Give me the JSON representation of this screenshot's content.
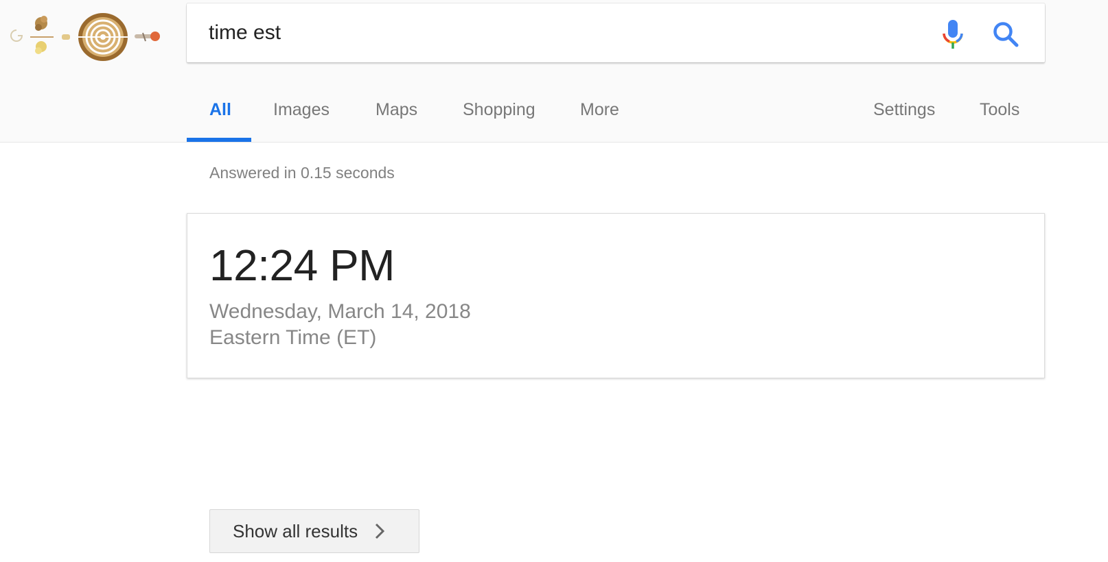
{
  "doodle": {
    "name": "google-doodle-logo"
  },
  "search": {
    "query": "time est",
    "mic_icon": "mic-icon",
    "search_icon": "search-icon"
  },
  "tabs": [
    {
      "label": "All",
      "active": true
    },
    {
      "label": "Images",
      "active": false
    },
    {
      "label": "Maps",
      "active": false
    },
    {
      "label": "Shopping",
      "active": false
    },
    {
      "label": "More",
      "active": false
    }
  ],
  "right_tabs": [
    {
      "label": "Settings"
    },
    {
      "label": "Tools"
    }
  ],
  "stats": "Answered in 0.15 seconds",
  "time_card": {
    "time": "12:24 PM",
    "date": "Wednesday, March 14, 2018",
    "timezone": "Eastern Time (ET)"
  },
  "show_all": {
    "label": "Show all results",
    "icon": "chevron-right-icon"
  },
  "colors": {
    "accent": "#1a73e8",
    "mic_blue": "#4285f4",
    "mic_red": "#ea4335",
    "mic_yellow": "#fbbc05",
    "mic_green": "#34a853"
  }
}
